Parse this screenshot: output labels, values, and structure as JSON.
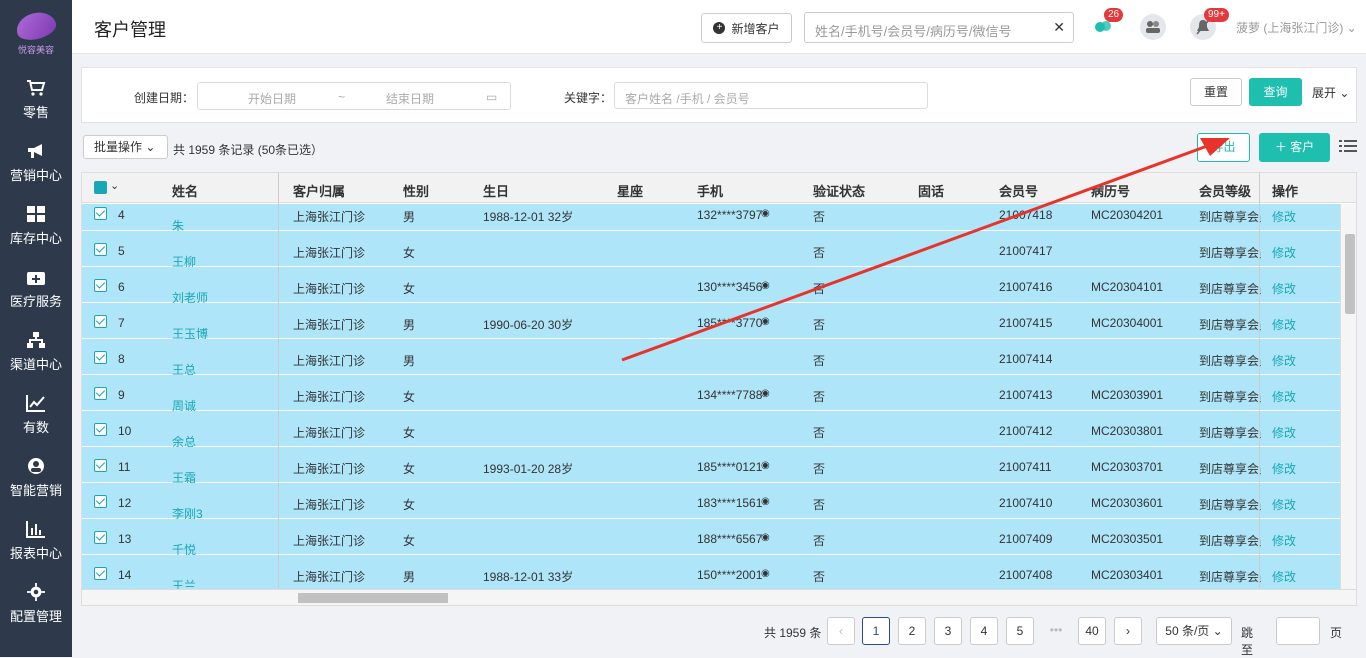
{
  "app": {
    "logo_text": "悦容美容",
    "page_title": "客户管理"
  },
  "sidebar": {
    "items": [
      {
        "label": "零售",
        "icon": "cart-icon"
      },
      {
        "label": "营销中心",
        "icon": "megaphone-icon"
      },
      {
        "label": "库存中心",
        "icon": "grid-icon"
      },
      {
        "label": "医疗服务",
        "icon": "medical-kit-icon"
      },
      {
        "label": "渠道中心",
        "icon": "network-icon"
      },
      {
        "label": "有数",
        "icon": "trend-chart-icon"
      },
      {
        "label": "智能营销",
        "icon": "smart-marketing-icon"
      },
      {
        "label": "报表中心",
        "icon": "bar-chart-icon"
      },
      {
        "label": "配置管理",
        "icon": "gear-icon"
      }
    ]
  },
  "header": {
    "new_customer_label": "新增客户",
    "search_placeholder": "姓名/手机号/会员号/病历号/微信号",
    "badge_chat": "26",
    "badge_notify": "99+",
    "user_name": "菠萝 (上海张江门诊)"
  },
  "filter": {
    "date_label": "创建日期：",
    "start_placeholder": "开始日期",
    "range_sep": "~",
    "end_placeholder": "结束日期",
    "keyword_label": "关键字：",
    "keyword_placeholder": "客户姓名 /手机 / 会员号",
    "reset_label": "重置",
    "query_label": "查询",
    "expand_label": "展开"
  },
  "toolbar": {
    "batch_label": "批量操作",
    "count_text": "共 1959 条记录   (50条已选）",
    "export_label": "导出",
    "add_label": "客户"
  },
  "table": {
    "columns": [
      "姓名",
      "客户归属",
      "性别",
      "生日",
      "星座",
      "手机",
      "验证状态",
      "固话",
      "会员号",
      "病历号",
      "会员等级",
      "操作"
    ],
    "rows": [
      {
        "no": "4",
        "name": "朱",
        "owner": "上海张江门诊",
        "gender": "男",
        "birthday": "1988-12-01   32岁",
        "phone": "132****3797",
        "verify": "否",
        "member": "21007418",
        "record": "MC20304201",
        "level": "到店尊享会员",
        "op": "修改"
      },
      {
        "no": "5",
        "name": "王柳",
        "owner": "上海张江门诊",
        "gender": "女",
        "birthday": "",
        "phone": "",
        "verify": "否",
        "member": "21007417",
        "record": "",
        "level": "到店尊享会员",
        "op": "修改"
      },
      {
        "no": "6",
        "name": "刘老师",
        "owner": "上海张江门诊",
        "gender": "女",
        "birthday": "",
        "phone": "130****3456",
        "verify": "否",
        "member": "21007416",
        "record": "MC20304101",
        "level": "到店尊享会员",
        "op": "修改"
      },
      {
        "no": "7",
        "name": "王玉博",
        "owner": "上海张江门诊",
        "gender": "男",
        "birthday": "1990-06-20   30岁",
        "phone": "185****3770",
        "verify": "否",
        "member": "21007415",
        "record": "MC20304001",
        "level": "到店尊享会员",
        "op": "修改"
      },
      {
        "no": "8",
        "name": "王总",
        "owner": "上海张江门诊",
        "gender": "男",
        "birthday": "",
        "phone": "",
        "verify": "否",
        "member": "21007414",
        "record": "",
        "level": "到店尊享会员",
        "op": "修改"
      },
      {
        "no": "9",
        "name": "周诚",
        "owner": "上海张江门诊",
        "gender": "女",
        "birthday": "",
        "phone": "134****7788",
        "verify": "否",
        "member": "21007413",
        "record": "MC20303901",
        "level": "到店尊享会员",
        "op": "修改"
      },
      {
        "no": "10",
        "name": "余总",
        "owner": "上海张江门诊",
        "gender": "女",
        "birthday": "",
        "phone": "",
        "verify": "否",
        "member": "21007412",
        "record": "MC20303801",
        "level": "到店尊享会员",
        "op": "修改"
      },
      {
        "no": "11",
        "name": "王霜",
        "owner": "上海张江门诊",
        "gender": "女",
        "birthday": "1993-01-20   28岁",
        "phone": "185****0121",
        "verify": "否",
        "member": "21007411",
        "record": "MC20303701",
        "level": "到店尊享会员",
        "op": "修改"
      },
      {
        "no": "12",
        "name": "李刚3",
        "owner": "上海张江门诊",
        "gender": "女",
        "birthday": "",
        "phone": "183****1561",
        "verify": "否",
        "member": "21007410",
        "record": "MC20303601",
        "level": "到店尊享会员",
        "op": "修改"
      },
      {
        "no": "13",
        "name": "千悦",
        "owner": "上海张江门诊",
        "gender": "女",
        "birthday": "",
        "phone": "188****6567",
        "verify": "否",
        "member": "21007409",
        "record": "MC20303501",
        "level": "到店尊享会员",
        "op": "修改"
      },
      {
        "no": "14",
        "name": "王兰",
        "owner": "上海张江门诊",
        "gender": "男",
        "birthday": "1988-12-01   33岁",
        "phone": "150****2001",
        "verify": "否",
        "member": "21007408",
        "record": "MC20303401",
        "level": "到店尊享会员",
        "op": "修改"
      }
    ]
  },
  "pagination": {
    "total_text": "共 1959 条",
    "pages": [
      "1",
      "2",
      "3",
      "4",
      "5",
      "•••",
      "40"
    ],
    "page_size": "50 条/页",
    "goto_label": "跳至",
    "page_unit": "页"
  },
  "colors": {
    "accent": "#1fbfb0",
    "row_selected": "#aee5f8",
    "sidebar": "#2e3a4c",
    "annotation_arrow": "#e8332a"
  }
}
